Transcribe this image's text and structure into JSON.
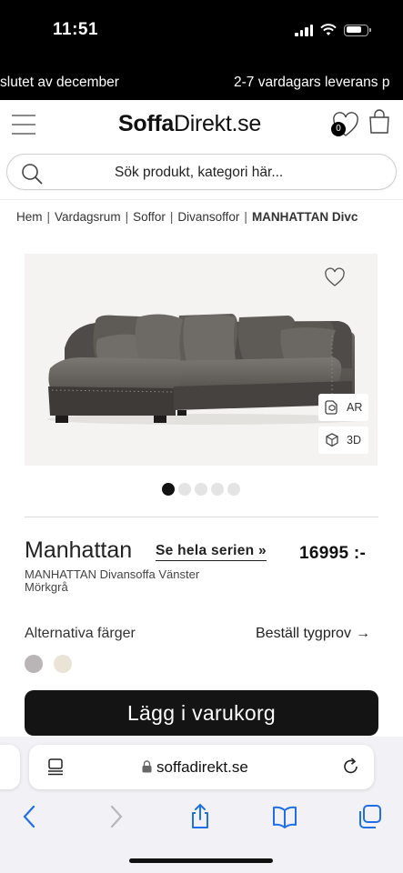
{
  "status_bar": {
    "time": "11:51"
  },
  "promo": {
    "left_text": "slutet av december",
    "right_text": "2-7 vardagars leverans p"
  },
  "header": {
    "logo_bold": "Soffa",
    "logo_light": "Direkt.se",
    "cart_count": "0"
  },
  "search": {
    "placeholder": "Sök produkt, kategori här..."
  },
  "breadcrumb": {
    "items": [
      "Hem",
      "Vardagsrum",
      "Soffor",
      "Divansoffor"
    ],
    "current": "MANHATTAN Divc"
  },
  "viewer": {
    "ar_label": "AR",
    "3d_label": "3D"
  },
  "product": {
    "name": "Manhattan",
    "series_link": "Se hela serien »",
    "price": "16995 :-",
    "subtitle": "MANHATTAN Divansoffa Vänster Mörkgrå"
  },
  "colors": {
    "label": "Alternativa färger",
    "fabric_sample_link": "Beställ tygprov",
    "swatches": [
      "#b9b5b6",
      "#e9e4d6"
    ]
  },
  "cta": {
    "add_to_cart": "Lägg i varukorg"
  },
  "browser": {
    "url": "soffadirekt.se"
  },
  "icons": {
    "menu": "hamburger-icon",
    "wishlist": "heart-icon",
    "cart": "bag-icon",
    "search": "search-icon",
    "lock": "lock-icon",
    "reload": "reload-icon",
    "back": "chevron-left-icon",
    "forward": "chevron-right-icon",
    "share": "share-icon",
    "bookmarks": "book-icon",
    "tabs": "tabs-icon"
  }
}
